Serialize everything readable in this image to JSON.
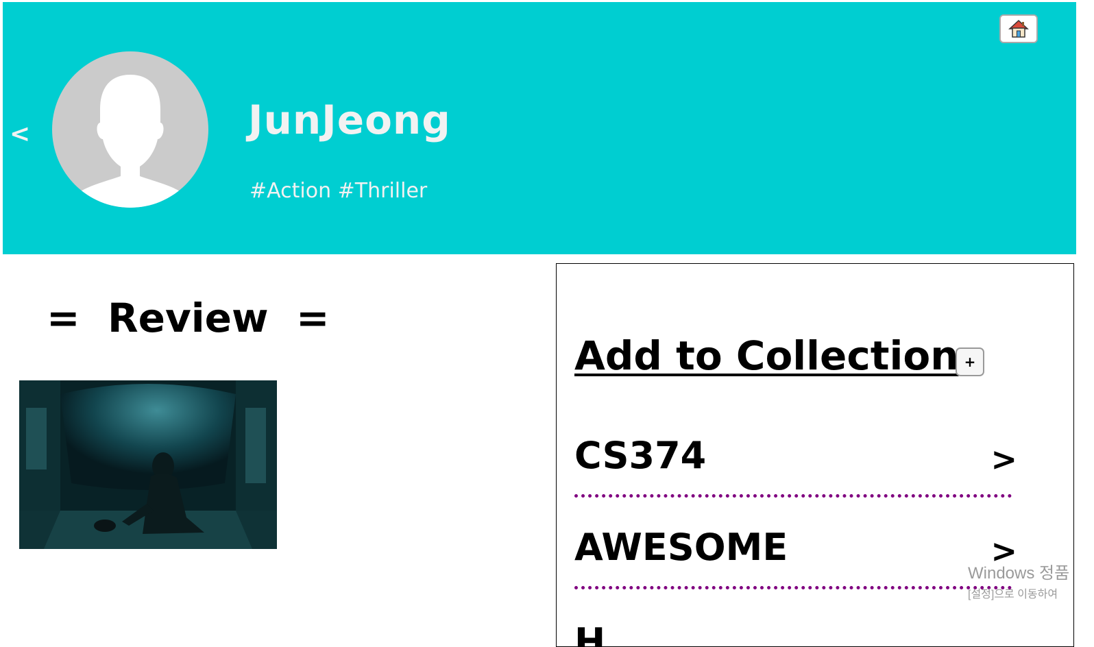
{
  "header": {
    "username": "JunJeong",
    "tags": "#Action #Thriller",
    "back_label": "<",
    "home_icon": "house-icon",
    "background_color": "#00ced1"
  },
  "review": {
    "title": "=  Review  =",
    "image_icon": "movie-still-image"
  },
  "collection": {
    "heading": "Add to Collection",
    "add_label": "+",
    "items": [
      {
        "name": "CS374",
        "arrow": ">"
      },
      {
        "name": "AWESOME",
        "arrow": ">"
      }
    ],
    "partial_item": "H",
    "divider_color": "#800080"
  },
  "watermark": {
    "line1": "Windows 정품",
    "line2": "[설정]으로 이동하여"
  }
}
